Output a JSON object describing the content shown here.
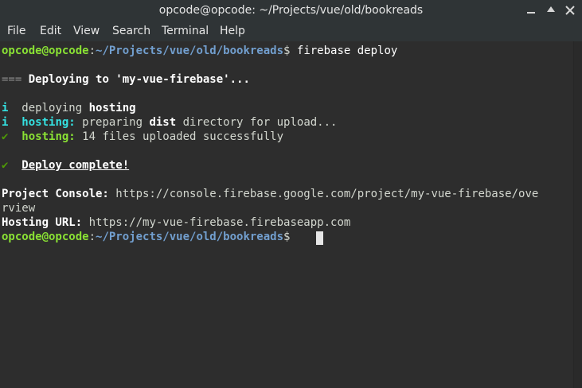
{
  "window": {
    "title": "opcode@opcode: ~/Projects/vue/old/bookreads"
  },
  "menu": {
    "items": [
      "File",
      "Edit",
      "View",
      "Search",
      "Terminal",
      "Help"
    ]
  },
  "terminal": {
    "prompt_user": "opcode@opcode",
    "prompt_colon": ":",
    "prompt_path": "~/Projects/vue/old/bookreads",
    "prompt_dollar": "$",
    "command": " firebase deploy",
    "heading_marker": "===",
    "heading_text": " Deploying to 'my-vue-firebase'...",
    "info_i": "i",
    "deploy_prefix": "  deploying ",
    "deploy_word": "hosting",
    "hosting_label": "hosting:",
    "prep_text_1": " preparing ",
    "prep_dist": "dist",
    "prep_text_2": " directory for upload...",
    "check": "✔",
    "uploaded_text": " 14 files uploaded successfully",
    "complete_text": "Deploy complete!",
    "console_label": "Project Console:",
    "console_url_1": " https://console.firebase.google.com/project/my-vue-firebase/ove",
    "console_url_2": "rview",
    "hosting_url_label": "Hosting URL:",
    "hosting_url": " https://my-vue-firebase.firebaseapp.com"
  }
}
